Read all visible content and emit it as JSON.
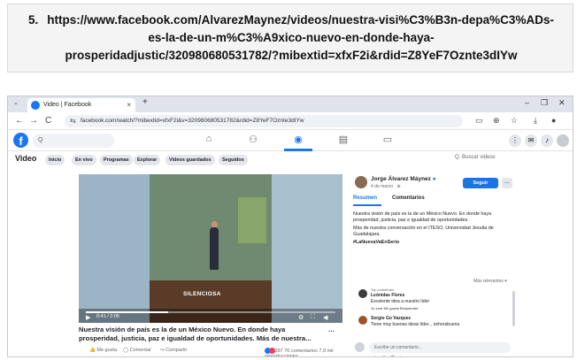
{
  "caption": {
    "number": "5.",
    "url_line1": "https://www.facebook.com/AlvarezMaynez/videos/nuestra-visi%C3%B3n-depa%C3%ADs-",
    "url_line2": "es-la-de-un-m%C3%A9xico-nuevo-en-donde-haya-",
    "url_line3": "prosperidadjustic/320980680531782/?mibextid=xfxF2i&rdid=Z8YeF7Oznte3dIYw"
  },
  "browser": {
    "tab_title": "Video | Facebook",
    "tab_close": "×",
    "new_tab": "+",
    "tab_list_icon": "⌄",
    "minimize": "–",
    "maximize": "❐",
    "close": "✕",
    "back": "←",
    "forward": "→",
    "reload": "C",
    "tune_icon": "⇆",
    "url": "facebook.com/watch/?mibextid=xfxF2i&v=320980680531782&rdid=Z8YeF7Oznte3dIYw"
  },
  "fb": {
    "logo": "f",
    "search_icon": "Q",
    "section_title": "Video",
    "tabs": [
      "Inicio",
      "En vivo",
      "Programas",
      "Explorar",
      "Videos guardados",
      "Seguidos"
    ],
    "search_videos": "Q. Buscar videos"
  },
  "video": {
    "sign_text": "SILENCIOSA",
    "time": "0:41 / 2:05",
    "progress": 0.33,
    "title": "Nuestra visión de país es la de un México Nuevo. En donde haya prosperidad, justicia, paz e igualdad de oportunidades. Más de nuestra...",
    "more": "...",
    "like": "Me gusta",
    "comment": "Comentar",
    "share": "Compartir",
    "reactions_count": "397",
    "comments_count": "76 comentarios",
    "views": "7,9 mil reproducciones"
  },
  "panel": {
    "author": "Jorge Álvarez Máynez",
    "verified": "●",
    "date": "4 de marzo · ⊕",
    "follow": "Seguir",
    "more": "...",
    "tab_summary": "Resumen",
    "tab_comments": "Comentarios",
    "text1": "Nuestra visión de país es la de un México Nuevo. En donde haya prosperidad, justicia, paz e igualdad de oportunidades.",
    "text2": "Más de nuestra conversación en el ITESO, Universidad Jesuita de Guadalajara.",
    "hashtag": "#LaNuevaVaEnSerio",
    "most_relevant": "Más relevantes ▾",
    "comment1_meta": "Top contributor",
    "comment1_name": "Leónidas Flores",
    "comment1_text": "Excelente idea a nuestro líder",
    "comment1_actions": "11 sem   Me gusta   Responder",
    "comment2_name": "Sergio Go Vazquez",
    "comment2_text": "Tiene muy buenas ideas líder... enhorabuena",
    "comment_placeholder": "Escribe un comentario...",
    "input_icons": "☺ ◎ ▣ ◐"
  }
}
